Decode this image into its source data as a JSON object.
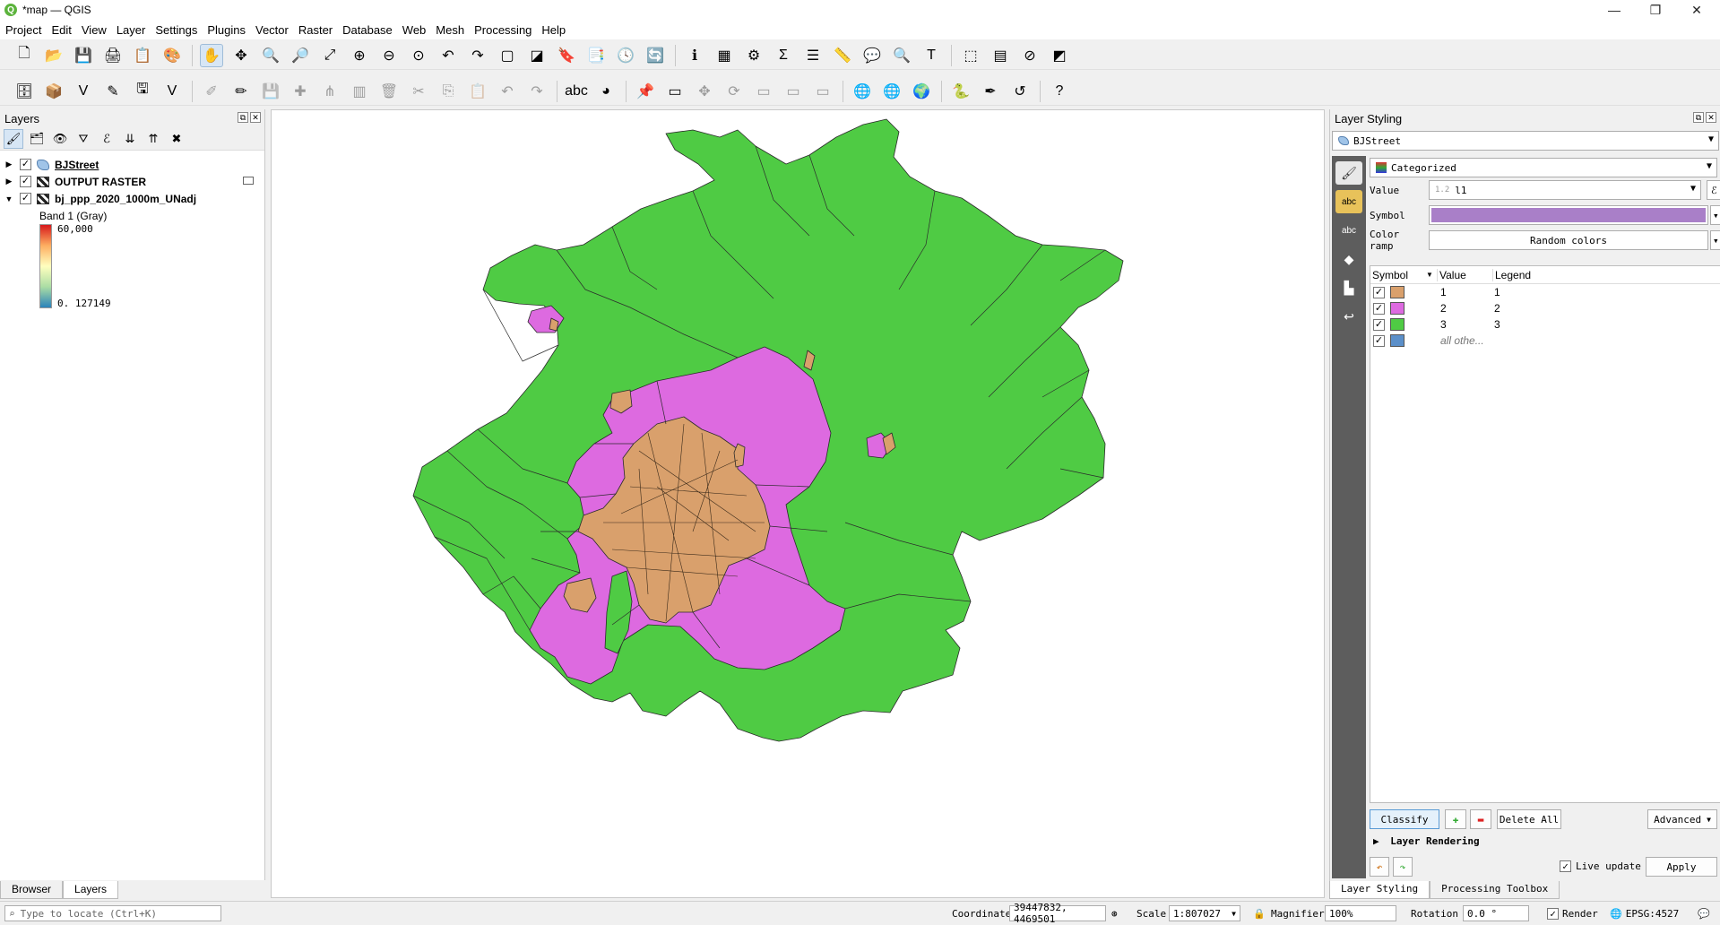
{
  "window": {
    "title": "*map — QGIS",
    "icon": "qgis-icon"
  },
  "menu": [
    "Project",
    "Edit",
    "View",
    "Layer",
    "Settings",
    "Plugins",
    "Vector",
    "Raster",
    "Database",
    "Web",
    "Mesh",
    "Processing",
    "Help"
  ],
  "layers_panel": {
    "title": "Layers",
    "layers": [
      {
        "name": "BJStreet",
        "checked": true,
        "type": "polygon",
        "icon": "polygon-layer-icon"
      },
      {
        "name": "OUTPUT RASTER",
        "checked": true,
        "type": "raster",
        "icon": "raster-layer-icon"
      },
      {
        "name": "bj_ppp_2020_1000m_UNadj",
        "checked": true,
        "type": "raster",
        "icon": "raster-layer-icon"
      }
    ],
    "band": {
      "label": "Band 1 (Gray)",
      "max": "60,000",
      "min": "0. 127149"
    },
    "tabs": [
      "Browser",
      "Layers"
    ]
  },
  "styling": {
    "title": "Layer Styling",
    "layer": "BJStreet",
    "renderer": "Categorized",
    "value_label": "Value",
    "value_prefix": "1.2",
    "value": "l1",
    "symbol_label": "Symbol",
    "symbol_color": "#a97fc8",
    "color_ramp_label": "Color ramp",
    "color_ramp": "Random colors",
    "columns": [
      "Symbol",
      "Value",
      "Legend"
    ],
    "categories": [
      {
        "value": "1",
        "legend": "1",
        "color": "#d9a06c",
        "checked": true
      },
      {
        "value": "2",
        "legend": "2",
        "color": "#dd6ae0",
        "checked": true
      },
      {
        "value": "3",
        "legend": "3",
        "color": "#4fcb44",
        "checked": true
      },
      {
        "value": "all othe...",
        "legend": "",
        "color": "#5b8fc9",
        "checked": true
      }
    ],
    "classify": "Classify",
    "delete_all": "Delete All",
    "advanced": "Advanced",
    "layer_rendering": "Layer Rendering",
    "live_update": "Live update",
    "apply": "Apply",
    "tabs": [
      "Layer Styling",
      "Processing Toolbox"
    ]
  },
  "status": {
    "locate_placeholder": "Type to locate (Ctrl+K)",
    "coordinate_label": "Coordinate",
    "coordinate": "39447832, 4469501",
    "scale_label": "Scale",
    "scale": "1:807027",
    "magnifier_label": "Magnifier",
    "magnifier": "100%",
    "rotation_label": "Rotation",
    "rotation": "0.0 °",
    "render_label": "Render",
    "crs": "EPSG:4527"
  },
  "map_colors": {
    "class1": "#d9a06c",
    "class2": "#dd6ae0",
    "class3": "#4fcb44",
    "border": "#2b2b2b"
  }
}
